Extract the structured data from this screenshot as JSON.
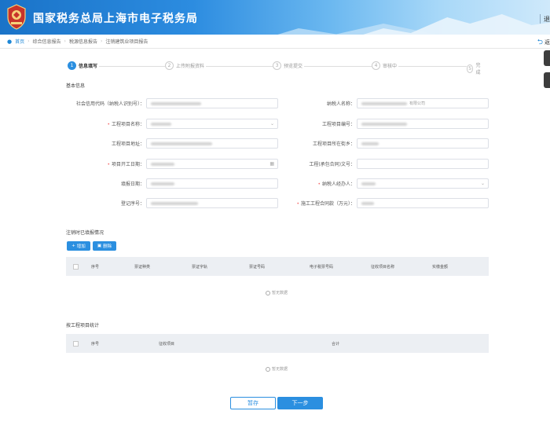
{
  "header": {
    "title": "国家税务总局上海市电子税务局",
    "right_text_1": "|",
    "right_text_2": "退"
  },
  "breadcrumb": {
    "items": [
      "首页",
      "综合信息报告",
      "税源信息报告",
      "注销建筑业项目报告"
    ],
    "back_label": "返"
  },
  "steps": [
    {
      "num": "1",
      "label": "信息填写"
    },
    {
      "num": "2",
      "label": "上传附报资料"
    },
    {
      "num": "3",
      "label": "预览提交"
    },
    {
      "num": "4",
      "label": "审核中"
    },
    {
      "num": "5",
      "label": "完成"
    }
  ],
  "sections": {
    "basic": "基本信息",
    "cancel": "注销时已填报情况",
    "project_stats": "按工程项目统计"
  },
  "form": {
    "credit_code_label": "社会信用代码（纳税人识别号）：",
    "taxpayer_name_label": "纳税人名称：",
    "taxpayer_name_value": "有限公司",
    "project_name_label": "工程项目名称：",
    "project_no_label": "工程项目编号：",
    "project_addr_label": "工程项目地址：",
    "project_dept_label": "工程项目所在街乡：",
    "start_date_label": "项目开工日期：",
    "bid_doc_label": "工程(承包合同)文号：",
    "fill_date_label": "填报日期：",
    "agent_label": "纳税人经办人：",
    "reg_no_label": "登记序号：",
    "contract_amount_label": "施工工程合同款（万元）："
  },
  "cancel_table": {
    "add_label": "增加",
    "delete_label": "删除",
    "columns": [
      "序号",
      "票证种类",
      "票证字轨",
      "票证号码",
      "电子税票号码",
      "征收项目名称",
      "实缴金额"
    ],
    "empty_text": "暂无数据"
  },
  "stats_table": {
    "columns": [
      "序号",
      "征收项目",
      "合计"
    ],
    "empty_text": "暂无数据"
  },
  "buttons": {
    "save": "暂存",
    "next": "下一步"
  },
  "colors": {
    "primary": "#2b8fe0",
    "required": "#f56c6c"
  }
}
